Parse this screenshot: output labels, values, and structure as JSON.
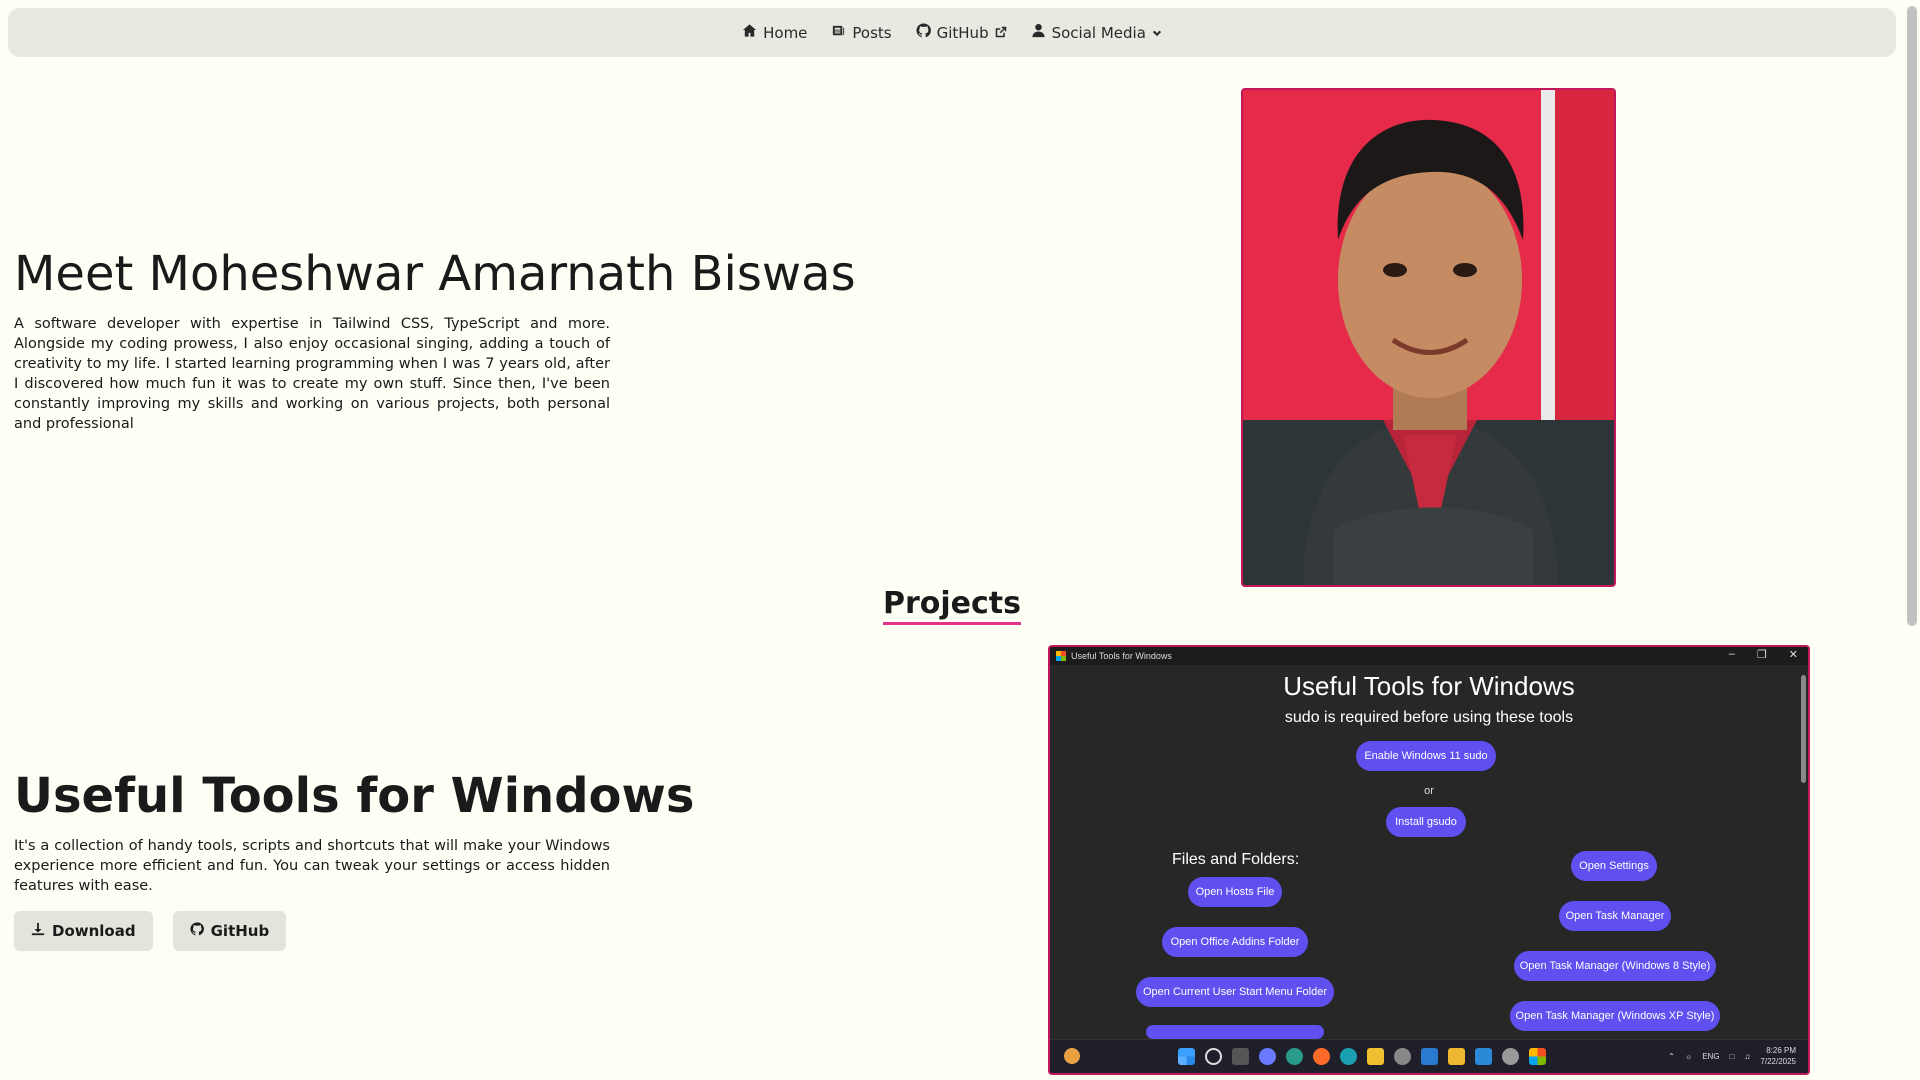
{
  "nav": {
    "home": "Home",
    "posts": "Posts",
    "github": "GitHub",
    "social": "Social Media"
  },
  "hero": {
    "title": "Meet Moheshwar Amarnath Biswas",
    "text": "A software developer with expertise in Tailwind CSS, TypeScript and more. Alongside my coding prowess, I also enjoy occasional singing, adding a touch of creativity to my life. I started learning programming when I was 7 years old, after I discovered how much fun it was to create my own stuff. Since then, I've been constantly improving my skills and working on various projects, both personal and professional"
  },
  "projects": {
    "heading": "Projects",
    "item": {
      "title": "Useful Tools for Windows",
      "text": "It's a collection of handy tools, scripts and shortcuts that will make your Windows experience more efficient and fun. You can tweak your settings or access hidden features with ease.",
      "download_label": "Download",
      "github_label": "GitHub"
    }
  },
  "app_screenshot": {
    "window_title": "Useful Tools for Windows",
    "title": "Useful Tools for Windows",
    "subtitle": "sudo is required before using these tools",
    "enable_sudo": "Enable Windows 11 sudo",
    "or": "or",
    "install_gsudo": "Install gsudo",
    "files_section": "Files and Folders:",
    "left_buttons": [
      "Open Hosts File",
      "Open Office Addins Folder",
      "Open Current User Start Menu Folder"
    ],
    "right_buttons": [
      "Open Settings",
      "Open Task Manager",
      "Open Task Manager (Windows 8 Style)",
      "Open Task Manager (Windows XP Style)"
    ],
    "tray_lang": "ENG",
    "clock_time": "8:26 PM",
    "clock_date": "7/22/2025"
  },
  "colors": {
    "accent": "#e0338a",
    "frame": "#c2185b",
    "pill": "#6050f0"
  }
}
